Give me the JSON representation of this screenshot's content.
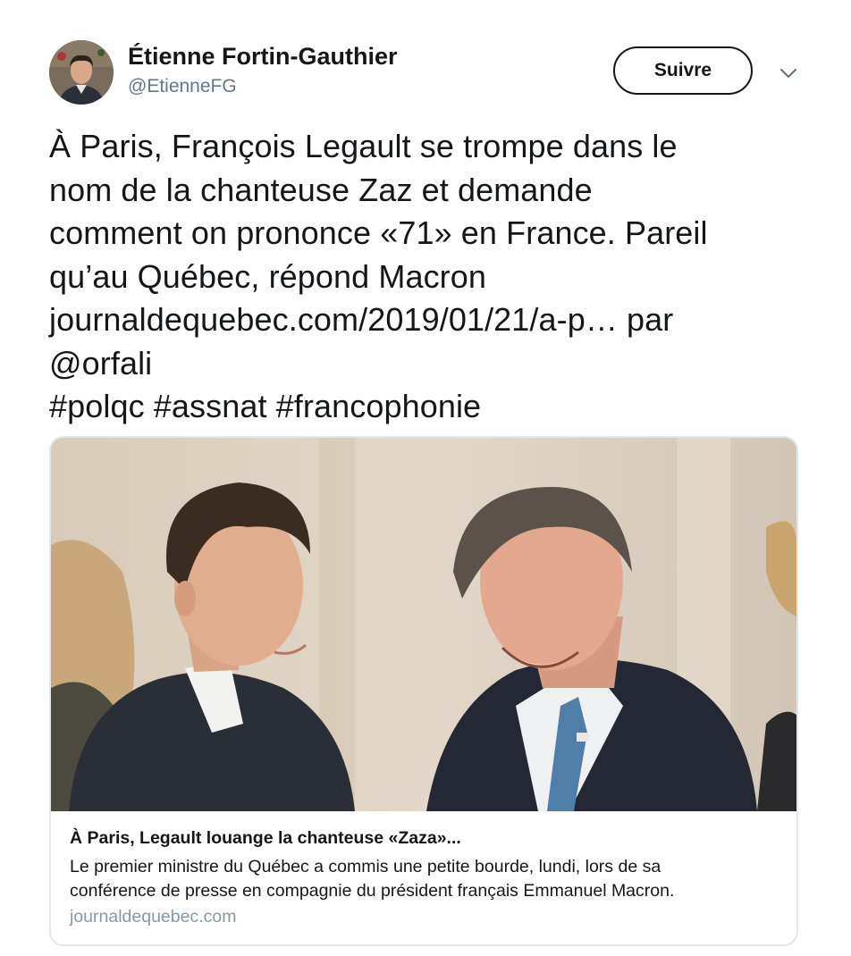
{
  "author": {
    "name": "Étienne Fortin-Gauthier",
    "handle": "@EtienneFG"
  },
  "follow_label": "Suivre",
  "tweet": {
    "lines": [
      "À Paris, François Legault se trompe dans le",
      "nom de la chanteuse Zaz et demande",
      "comment on prononce «71» en France. Pareil",
      "qu’au Québec, répond Macron",
      "journaldequebec.com/2019/01/21/a-p… par",
      "@orfali",
      "#polqc #assnat #francophonie"
    ]
  },
  "card": {
    "title": "À Paris, Legault louange la chanteuse «Zaza»...",
    "description_lines": [
      "Le premier ministre du Québec a commis une petite bourde, lundi, lors de sa",
      "conférence de presse en compagnie du président français Emmanuel Macron."
    ],
    "domain": "journaldequebec.com"
  },
  "icons": {
    "caret": "chevron-down-icon"
  },
  "colors": {
    "text": "#14171a",
    "secondary": "#657786",
    "domain": "#8899a6",
    "border": "#e1e8ed"
  }
}
